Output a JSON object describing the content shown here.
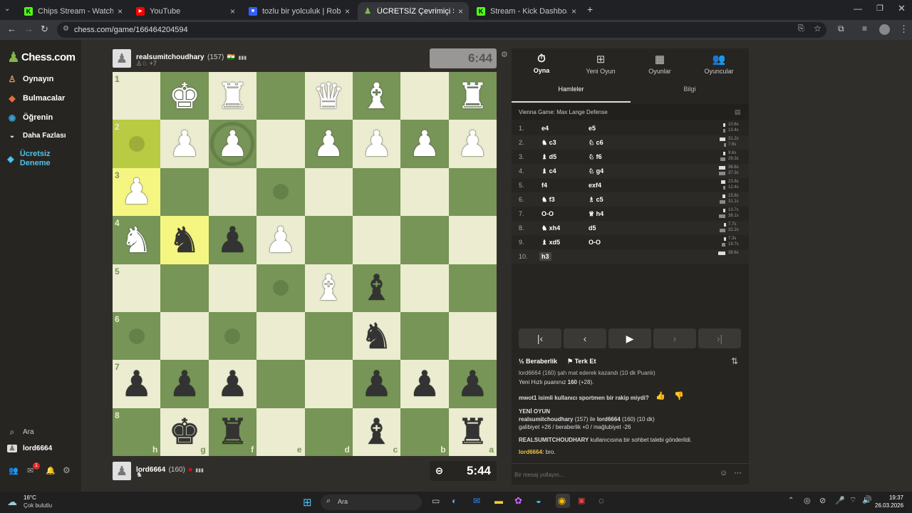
{
  "browser": {
    "tabs": [
      {
        "title": "Chips Stream - Watch Live on K",
        "fav": "K",
        "color": "#53fc18"
      },
      {
        "title": "YouTube",
        "fav": "▶",
        "color": "#ff0000"
      },
      {
        "title": "tozlu bir yolculuk | Roblox'ta Oy",
        "fav": "■",
        "color": "#335fff"
      },
      {
        "title": "ÜCRETSİZ Çevrimiçi Satranç Oy",
        "fav": "♟",
        "color": "#81b64c"
      },
      {
        "title": "Stream - Kick Dashboard",
        "fav": "K",
        "color": "#53fc18"
      }
    ],
    "url": "chess.com/game/166464204594"
  },
  "sidebar": {
    "logo": "Chess.com",
    "items": [
      {
        "label": "Oynayın",
        "icon": "play-icon"
      },
      {
        "label": "Bulmacalar",
        "icon": "puzzle-icon"
      },
      {
        "label": "Öğrenin",
        "icon": "learn-icon"
      },
      {
        "label": "Daha Fazlası",
        "icon": "chevron-down-icon"
      },
      {
        "label": "Ücretsiz Deneme",
        "icon": "diamond-icon"
      }
    ],
    "search": "Ara",
    "user": "lord6664",
    "notif_count": "1"
  },
  "top_player": {
    "name": "realsumitchoudhary",
    "rating": "(157)",
    "captured": "+7",
    "clock": "6:44"
  },
  "bottom_player": {
    "name": "lord6664",
    "rating": "(160)",
    "clock": "5:44"
  },
  "board": {
    "ranks": [
      "1",
      "2",
      "3",
      "4",
      "5",
      "6",
      "7",
      "8"
    ],
    "files": [
      "h",
      "g",
      "f",
      "e",
      "d",
      "c",
      "b",
      "a"
    ],
    "pieces": [
      [
        "",
        "wK",
        "wR",
        "",
        "wQ",
        "wB",
        "",
        "wR"
      ],
      [
        "",
        "wP",
        "wP",
        "",
        "wP",
        "wP",
        "wP",
        "wP"
      ],
      [
        "wP",
        "",
        "",
        "",
        "",
        "",
        "",
        ""
      ],
      [
        "wN",
        "bN",
        "bP",
        "wP",
        "",
        "",
        "",
        ""
      ],
      [
        "",
        "",
        "",
        "",
        "wB",
        "bB",
        "",
        ""
      ],
      [
        "",
        "",
        "",
        "",
        "",
        "bN",
        "",
        ""
      ],
      [
        "bP",
        "bP",
        "bP",
        "",
        "",
        "bP",
        "bP",
        "bP"
      ],
      [
        "",
        "bK",
        "bR",
        "",
        "",
        "bB",
        "",
        "bR"
      ]
    ],
    "highlights": [
      [
        1,
        0
      ],
      [
        2,
        0
      ],
      [
        3,
        1
      ]
    ],
    "dots": [
      [
        1,
        0
      ],
      [
        2,
        3
      ],
      [
        4,
        3
      ],
      [
        5,
        0
      ],
      [
        5,
        2
      ]
    ],
    "rings": [
      [
        1,
        2
      ]
    ]
  },
  "panel": {
    "tabs": [
      {
        "label": "Oyna",
        "icon": "clock-icon"
      },
      {
        "label": "Yeni Oyun",
        "icon": "plus-icon"
      },
      {
        "label": "Oyunlar",
        "icon": "board-icon"
      },
      {
        "label": "Oyuncular",
        "icon": "players-icon"
      }
    ],
    "subtabs": [
      "Hamleler",
      "Bilgi"
    ],
    "opening": "Vienna Game: Max Lange Defense",
    "moves": [
      {
        "n": "1.",
        "w": "e4",
        "b": "e5",
        "tw": "10.6s",
        "tb": "13.4s",
        "fw": 0.2,
        "fb": 0.25
      },
      {
        "n": "2.",
        "w": "♞ c3",
        "b": "♘ c6",
        "tw": "31.2s",
        "tb": "7.6s",
        "fw": 0.55,
        "fb": 0.15
      },
      {
        "n": "3.",
        "w": "♝ d5",
        "b": "♘ f6",
        "tw": "9.6s",
        "tb": "29.3s",
        "fw": 0.18,
        "fb": 0.5
      },
      {
        "n": "4.",
        "w": "♝ c4",
        "b": "♘ g4",
        "tw": "36.6s",
        "tb": "37.3s",
        "fw": 0.65,
        "fb": 0.65
      },
      {
        "n": "5.",
        "w": "f4",
        "b": "exf4",
        "tw": "23.8s",
        "tb": "12.4s",
        "fw": 0.42,
        "fb": 0.22
      },
      {
        "n": "6.",
        "w": "♞ f3",
        "b": "♗ c5",
        "tw": "15.8s",
        "tb": "31.1s",
        "fw": 0.28,
        "fb": 0.55
      },
      {
        "n": "7.",
        "w": "O-O",
        "b": "♕ h4",
        "tw": "13.7s",
        "tb": "38.1s",
        "fw": 0.25,
        "fb": 0.67
      },
      {
        "n": "8.",
        "w": "♞ xh4",
        "b": "d5",
        "tw": "7.7s",
        "tb": "32.2s",
        "fw": 0.14,
        "fb": 0.57
      },
      {
        "n": "9.",
        "w": "♝ xd5",
        "b": "O-O",
        "tw": "7.3s",
        "tb": "19.7s",
        "fw": 0.13,
        "fb": 0.35
      },
      {
        "n": "10.",
        "w": "h3",
        "b": "",
        "tw": "38.6s",
        "tb": "",
        "fw": 0.68,
        "fb": 0
      }
    ],
    "draw": "Beraberlik",
    "resign": "Terk Et",
    "chat": {
      "l1": "lord6664 (160) şah mat ederek kazandı (10 dk Puanlı)",
      "l2a": "Yeni Hızlı puanınız ",
      "l2b": "160",
      "l2c": " (+28).",
      "q": "mwot1 isimli kullanıcı sportmen bir rakip miydi?",
      "newgame": "YENİ OYUN",
      "g1a": "realsumitchoudhary",
      "g1b": " (157) ile ",
      "g1c": "lord6664",
      "g1d": " (160) (10 dk)",
      "g2": "galibiyet +26 / beraberlik +0 / mağlubiyet -26",
      "req1": "REALSUMITCHOUDHARY",
      "req2": " kullanıcısına bir sohbet talebi gönderildi.",
      "me": "lord6664:",
      "msg": " bro.",
      "placeholder": "Bir mesaj yollayın..."
    }
  },
  "taskbar": {
    "temp": "16°C",
    "weather": "Çok bulutlu",
    "search": "Ara",
    "time": "19:37",
    "date": "26.03.2026"
  }
}
